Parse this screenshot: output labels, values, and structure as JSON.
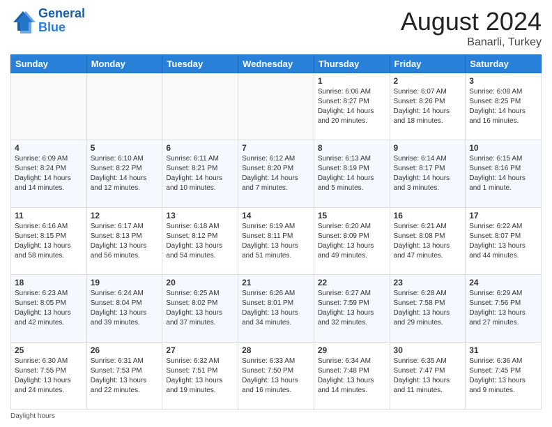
{
  "header": {
    "logo_line1": "General",
    "logo_line2": "Blue",
    "month_title": "August 2024",
    "subtitle": "Banarli, Turkey"
  },
  "days_of_week": [
    "Sunday",
    "Monday",
    "Tuesday",
    "Wednesday",
    "Thursday",
    "Friday",
    "Saturday"
  ],
  "weeks": [
    {
      "days": [
        {
          "num": "",
          "info": ""
        },
        {
          "num": "",
          "info": ""
        },
        {
          "num": "",
          "info": ""
        },
        {
          "num": "",
          "info": ""
        },
        {
          "num": "1",
          "info": "Sunrise: 6:06 AM\nSunset: 8:27 PM\nDaylight: 14 hours and 20 minutes."
        },
        {
          "num": "2",
          "info": "Sunrise: 6:07 AM\nSunset: 8:26 PM\nDaylight: 14 hours and 18 minutes."
        },
        {
          "num": "3",
          "info": "Sunrise: 6:08 AM\nSunset: 8:25 PM\nDaylight: 14 hours and 16 minutes."
        }
      ]
    },
    {
      "days": [
        {
          "num": "4",
          "info": "Sunrise: 6:09 AM\nSunset: 8:24 PM\nDaylight: 14 hours and 14 minutes."
        },
        {
          "num": "5",
          "info": "Sunrise: 6:10 AM\nSunset: 8:22 PM\nDaylight: 14 hours and 12 minutes."
        },
        {
          "num": "6",
          "info": "Sunrise: 6:11 AM\nSunset: 8:21 PM\nDaylight: 14 hours and 10 minutes."
        },
        {
          "num": "7",
          "info": "Sunrise: 6:12 AM\nSunset: 8:20 PM\nDaylight: 14 hours and 7 minutes."
        },
        {
          "num": "8",
          "info": "Sunrise: 6:13 AM\nSunset: 8:19 PM\nDaylight: 14 hours and 5 minutes."
        },
        {
          "num": "9",
          "info": "Sunrise: 6:14 AM\nSunset: 8:17 PM\nDaylight: 14 hours and 3 minutes."
        },
        {
          "num": "10",
          "info": "Sunrise: 6:15 AM\nSunset: 8:16 PM\nDaylight: 14 hours and 1 minute."
        }
      ]
    },
    {
      "days": [
        {
          "num": "11",
          "info": "Sunrise: 6:16 AM\nSunset: 8:15 PM\nDaylight: 13 hours and 58 minutes."
        },
        {
          "num": "12",
          "info": "Sunrise: 6:17 AM\nSunset: 8:13 PM\nDaylight: 13 hours and 56 minutes."
        },
        {
          "num": "13",
          "info": "Sunrise: 6:18 AM\nSunset: 8:12 PM\nDaylight: 13 hours and 54 minutes."
        },
        {
          "num": "14",
          "info": "Sunrise: 6:19 AM\nSunset: 8:11 PM\nDaylight: 13 hours and 51 minutes."
        },
        {
          "num": "15",
          "info": "Sunrise: 6:20 AM\nSunset: 8:09 PM\nDaylight: 13 hours and 49 minutes."
        },
        {
          "num": "16",
          "info": "Sunrise: 6:21 AM\nSunset: 8:08 PM\nDaylight: 13 hours and 47 minutes."
        },
        {
          "num": "17",
          "info": "Sunrise: 6:22 AM\nSunset: 8:07 PM\nDaylight: 13 hours and 44 minutes."
        }
      ]
    },
    {
      "days": [
        {
          "num": "18",
          "info": "Sunrise: 6:23 AM\nSunset: 8:05 PM\nDaylight: 13 hours and 42 minutes."
        },
        {
          "num": "19",
          "info": "Sunrise: 6:24 AM\nSunset: 8:04 PM\nDaylight: 13 hours and 39 minutes."
        },
        {
          "num": "20",
          "info": "Sunrise: 6:25 AM\nSunset: 8:02 PM\nDaylight: 13 hours and 37 minutes."
        },
        {
          "num": "21",
          "info": "Sunrise: 6:26 AM\nSunset: 8:01 PM\nDaylight: 13 hours and 34 minutes."
        },
        {
          "num": "22",
          "info": "Sunrise: 6:27 AM\nSunset: 7:59 PM\nDaylight: 13 hours and 32 minutes."
        },
        {
          "num": "23",
          "info": "Sunrise: 6:28 AM\nSunset: 7:58 PM\nDaylight: 13 hours and 29 minutes."
        },
        {
          "num": "24",
          "info": "Sunrise: 6:29 AM\nSunset: 7:56 PM\nDaylight: 13 hours and 27 minutes."
        }
      ]
    },
    {
      "days": [
        {
          "num": "25",
          "info": "Sunrise: 6:30 AM\nSunset: 7:55 PM\nDaylight: 13 hours and 24 minutes."
        },
        {
          "num": "26",
          "info": "Sunrise: 6:31 AM\nSunset: 7:53 PM\nDaylight: 13 hours and 22 minutes."
        },
        {
          "num": "27",
          "info": "Sunrise: 6:32 AM\nSunset: 7:51 PM\nDaylight: 13 hours and 19 minutes."
        },
        {
          "num": "28",
          "info": "Sunrise: 6:33 AM\nSunset: 7:50 PM\nDaylight: 13 hours and 16 minutes."
        },
        {
          "num": "29",
          "info": "Sunrise: 6:34 AM\nSunset: 7:48 PM\nDaylight: 13 hours and 14 minutes."
        },
        {
          "num": "30",
          "info": "Sunrise: 6:35 AM\nSunset: 7:47 PM\nDaylight: 13 hours and 11 minutes."
        },
        {
          "num": "31",
          "info": "Sunrise: 6:36 AM\nSunset: 7:45 PM\nDaylight: 13 hours and 9 minutes."
        }
      ]
    }
  ],
  "footer": {
    "note": "Daylight hours"
  }
}
